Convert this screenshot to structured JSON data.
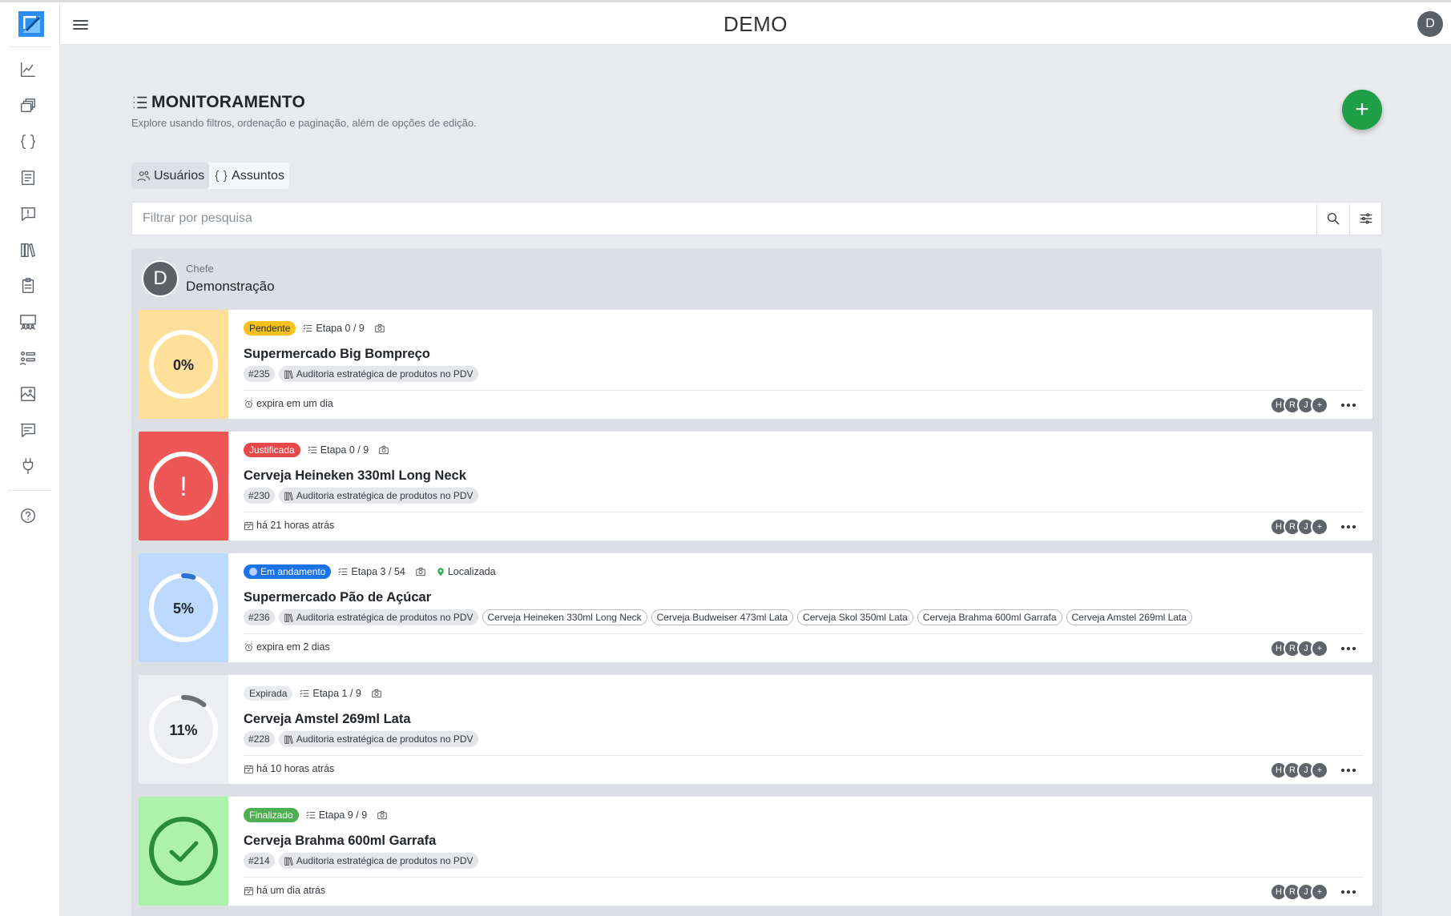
{
  "app": {
    "brand": "DEMO",
    "user_initial": "D"
  },
  "sidebar": {
    "items": [
      {
        "icon": "chart-line-icon"
      },
      {
        "icon": "stacked-cards-icon"
      },
      {
        "icon": "braces-icon"
      },
      {
        "icon": "checklist-icon"
      },
      {
        "icon": "alert-message-icon"
      },
      {
        "icon": "library-icon"
      },
      {
        "icon": "clipboard-icon"
      },
      {
        "icon": "team-board-icon"
      },
      {
        "icon": "users-list-icon"
      },
      {
        "icon": "gallery-icon"
      },
      {
        "icon": "chat-icon"
      },
      {
        "icon": "plug-icon"
      },
      {
        "icon": "help-icon"
      }
    ]
  },
  "header": {
    "title": "MONITORAMENTO",
    "subtitle": "Explore usando filtros, ordenação e paginação, além de opções de edição."
  },
  "tabs": [
    {
      "label": "Usuários",
      "active": true
    },
    {
      "label": "Assuntos",
      "active": false
    }
  ],
  "search": {
    "placeholder": "Filtrar por pesquisa"
  },
  "group": {
    "initial": "D",
    "role": "Chefe",
    "name": "Demonstração"
  },
  "tasks": [
    {
      "progress_label": "0%",
      "progress": 0,
      "state": "pending",
      "status": "Pendente",
      "status_colors": {
        "bg": "#f9c21b",
        "fg": "#212529"
      },
      "panel_color": "#ffe09a",
      "etapa": "Etapa 0 / 9",
      "location": "",
      "title": "Supermercado Big Bompreço",
      "id": "#235",
      "category": "Auditoria estratégica de produtos no PDV",
      "products": [],
      "meta_icon": "alarm-icon",
      "meta": "expira em um dia",
      "members": [
        "H",
        "R",
        "J",
        "+"
      ]
    },
    {
      "progress_label": "!",
      "progress": 0,
      "state": "justified",
      "status": "Justificada",
      "status_colors": {
        "bg": "#e8484a",
        "fg": "#ffffff"
      },
      "panel_color": "#ef5656",
      "etapa": "Etapa 0 / 9",
      "location": "",
      "title": "Cerveja Heineken 330ml Long Neck",
      "id": "#230",
      "category": "Auditoria estratégica de produtos no PDV",
      "products": [],
      "meta_icon": "calendar-icon",
      "meta": "há 21 horas atrás",
      "members": [
        "H",
        "R",
        "J",
        "+"
      ]
    },
    {
      "progress_label": "5%",
      "progress": 5,
      "state": "in-progress",
      "status": "Em andamento",
      "status_colors": {
        "bg": "#1a73e8",
        "fg": "#ffffff"
      },
      "panel_color": "#bdd9ff",
      "etapa": "Etapa 3 / 54",
      "location": "Localizada",
      "title": "Supermercado Pão de Açúcar",
      "id": "#236",
      "category": "Auditoria estratégica de produtos no PDV",
      "products": [
        "Cerveja Heineken 330ml Long Neck",
        "Cerveja Budweiser 473ml Lata",
        "Cerveja Skol 350ml Lata",
        "Cerveja Brahma 600ml Garrafa",
        "Cerveja Amstel 269ml Lata"
      ],
      "meta_icon": "alarm-icon",
      "meta": "expira em 2 dias",
      "members": [
        "H",
        "R",
        "J",
        "+"
      ]
    },
    {
      "progress_label": "11%",
      "progress": 11,
      "state": "expired",
      "status": "Expirada",
      "status_colors": {
        "bg": "#e9ebee",
        "fg": "#343a40"
      },
      "panel_color": "#eceef1",
      "etapa": "Etapa 1 / 9",
      "location": "",
      "title": "Cerveja Amstel 269ml Lata",
      "id": "#228",
      "category": "Auditoria estratégica de produtos no PDV",
      "products": [],
      "meta_icon": "calendar-icon",
      "meta": "há 10 horas atrás",
      "members": [
        "H",
        "R",
        "J",
        "+"
      ]
    },
    {
      "progress_label": "✓",
      "progress": 100,
      "state": "done",
      "status": "Finalizado",
      "status_colors": {
        "bg": "#4caf50",
        "fg": "#ffffff"
      },
      "panel_color": "#acf2ac",
      "etapa": "Etapa 9 / 9",
      "location": "",
      "title": "Cerveja Brahma 600ml Garrafa",
      "id": "#214",
      "category": "Auditoria estratégica de produtos no PDV",
      "products": [],
      "meta_icon": "calendar-icon",
      "meta": "há um dia atrás",
      "members": [
        "H",
        "R",
        "J",
        "+"
      ]
    }
  ],
  "colors": {
    "accent": "#1e9e46",
    "progress_track": "#ffffff",
    "progress_blue": "#2c6fd6",
    "progress_gray": "#6b7076",
    "done_green": "#2a8c3a"
  }
}
